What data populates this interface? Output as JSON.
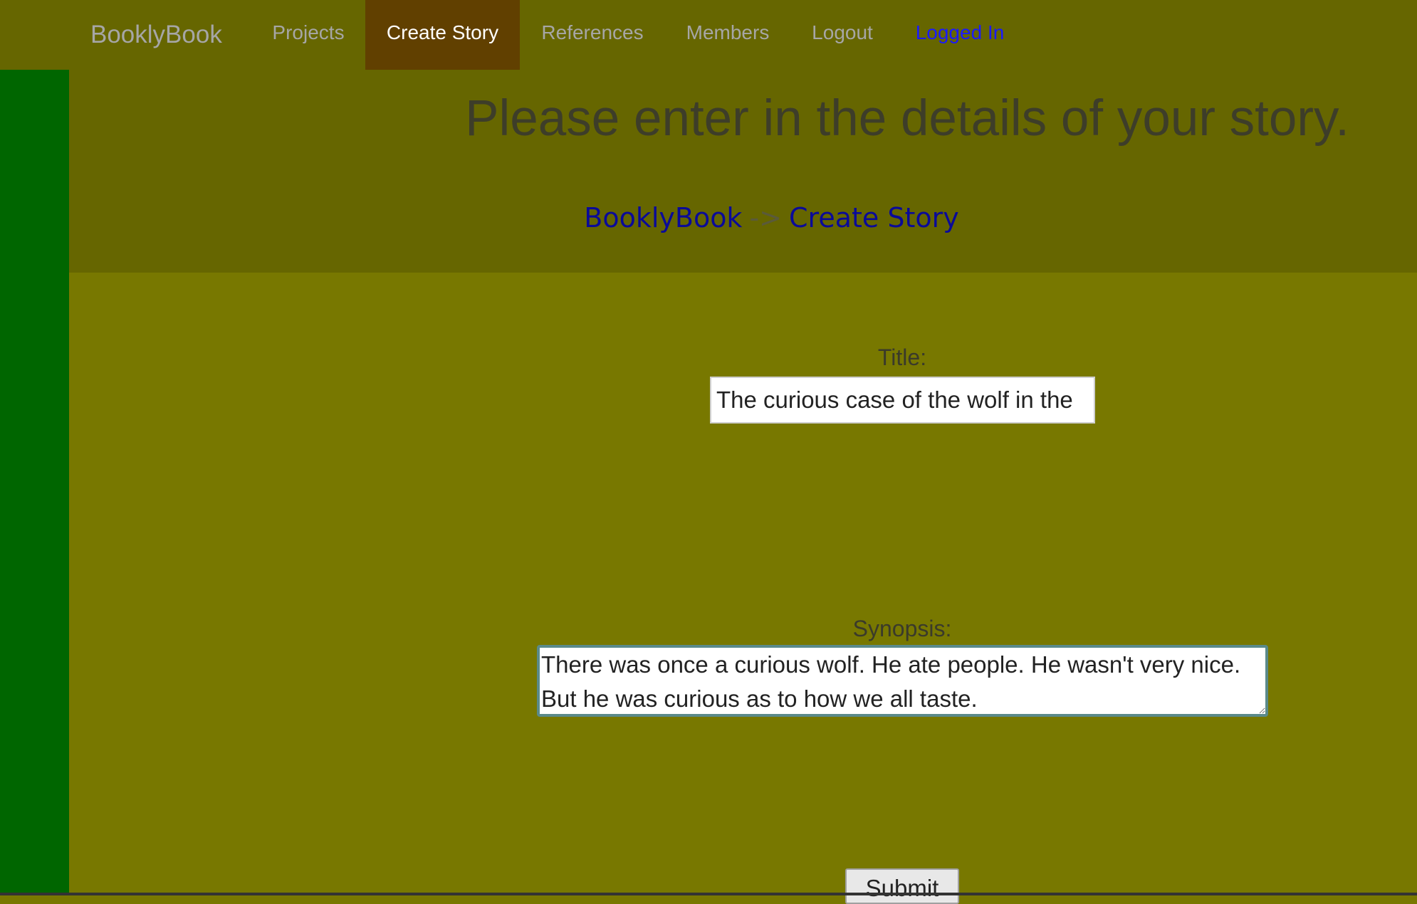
{
  "navbar": {
    "brand": "BooklyBook",
    "items": [
      {
        "label": "Projects"
      },
      {
        "label": "Create Story",
        "active": true
      },
      {
        "label": "References"
      },
      {
        "label": "Members"
      },
      {
        "label": "Logout"
      },
      {
        "label": "Logged In"
      }
    ]
  },
  "header": {
    "heading": "Please enter in the details of your story.",
    "breadcrumb": {
      "home": "BooklyBook",
      "separator": "->",
      "current": "Create Story"
    }
  },
  "form": {
    "title_label": "Title:",
    "title_value": "The curious case of the wolf in the",
    "synopsis_label": "Synopsis:",
    "synopsis_value": "There was once a curious wolf. He ate people. He wasn't very nice. But he was curious as to how we all taste.",
    "submit_label": "Submit"
  },
  "colors": {
    "navbar": "#666600",
    "page": "#787800",
    "sidebar": "#006600",
    "active_tab": "#614000",
    "link": "#0a0a99"
  }
}
